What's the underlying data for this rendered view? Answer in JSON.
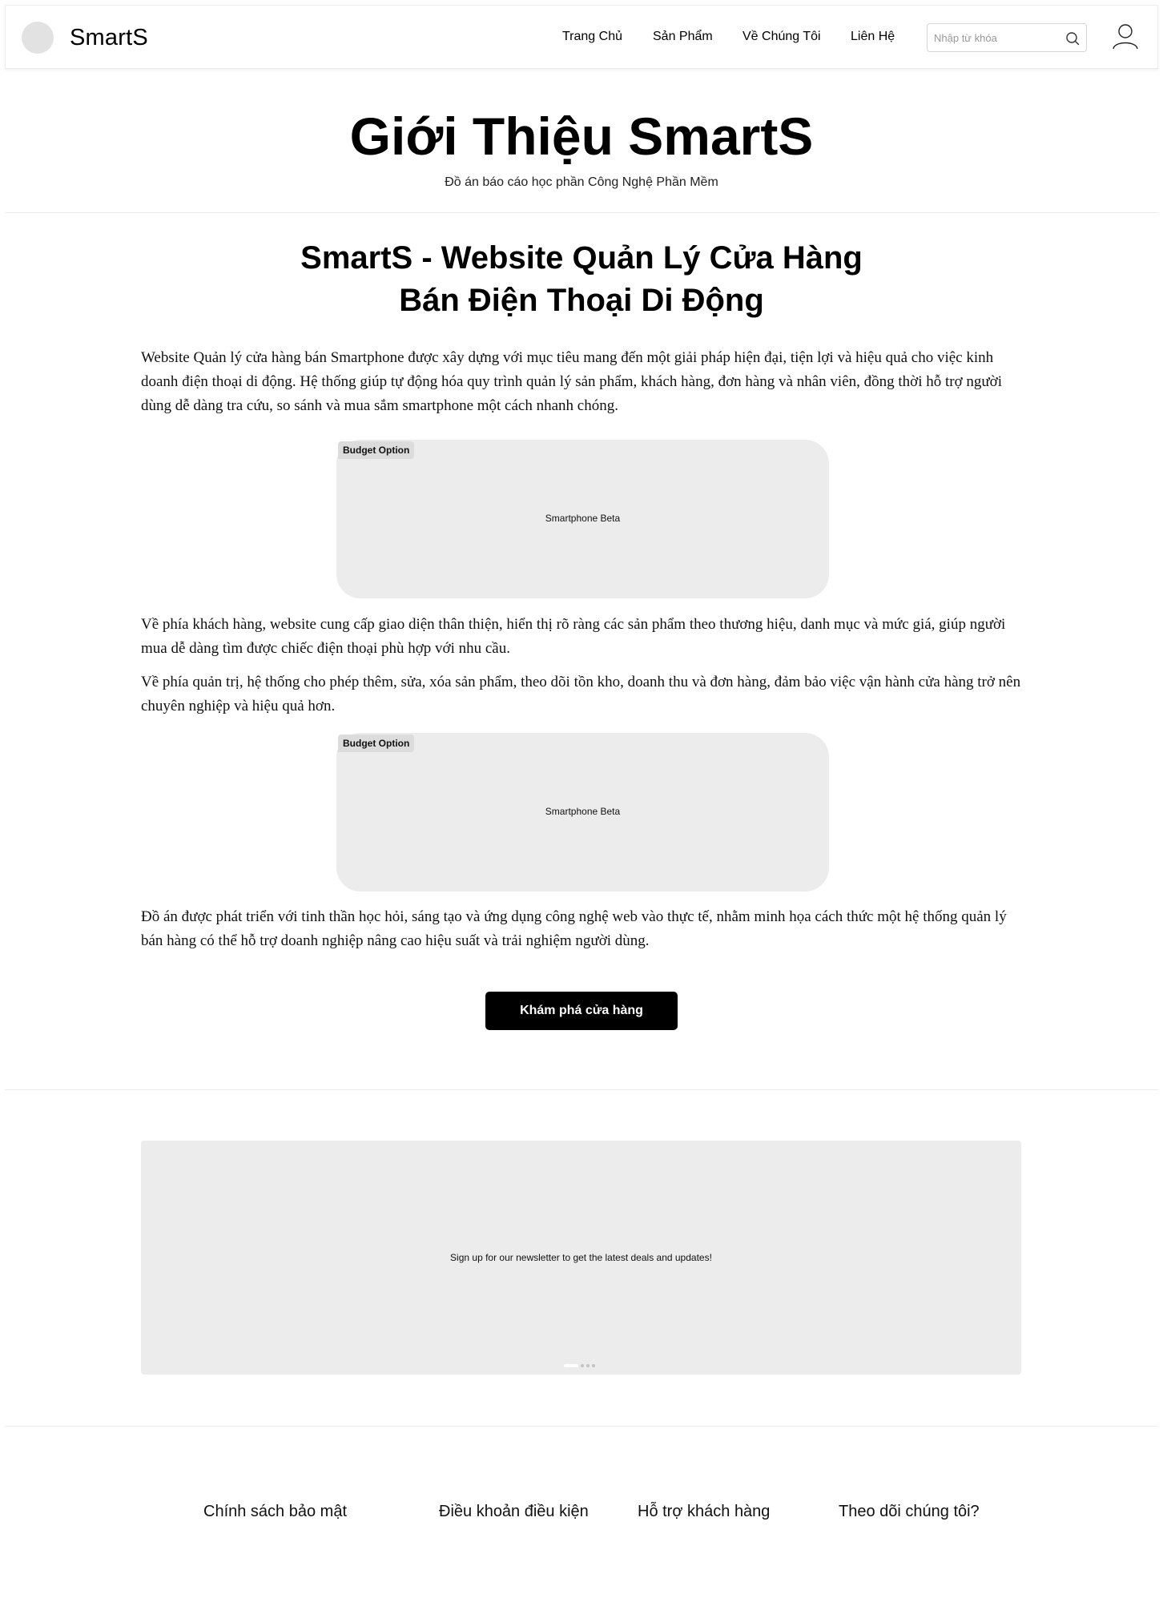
{
  "header": {
    "brand": "SmartS",
    "nav": [
      "Trang Chủ",
      "Sản Phẩm",
      "Về Chúng Tôi",
      "Liên Hệ"
    ],
    "search_placeholder": "Nhập từ khóa",
    "search_value": ""
  },
  "hero": {
    "title": "Giới Thiệu SmartS",
    "subtitle": "Đồ án báo cáo học phần Công Nghệ Phần Mềm"
  },
  "section": {
    "title_line1": "SmartS - Website Quản Lý Cửa Hàng",
    "title_line2": "Bán Điện Thoại Di Động",
    "p1": "Website Quản lý cửa hàng bán Smartphone được xây dựng với mục tiêu mang đến một giải pháp hiện đại, tiện lợi và hiệu quả cho việc kinh doanh điện thoại di động. Hệ thống giúp tự động hóa quy trình quản lý sản phẩm, khách hàng, đơn hàng và nhân viên, đồng thời hỗ trợ người dùng dễ dàng tra cứu, so sánh và mua sắm smartphone một cách nhanh chóng.",
    "card1": {
      "badge": "Budget Option",
      "label": "Smartphone Beta"
    },
    "p2": "Về phía khách hàng, website cung cấp giao diện thân thiện, hiển thị rõ ràng các sản phẩm theo thương hiệu, danh mục và mức giá, giúp người mua dễ dàng tìm được chiếc điện thoại phù hợp với nhu cầu.",
    "p3": "Về phía quản trị, hệ thống cho phép thêm, sửa, xóa sản phẩm, theo dõi tồn kho, doanh thu và đơn hàng, đảm bảo việc vận hành cửa hàng trở nên chuyên nghiệp và hiệu quả hơn.",
    "card2": {
      "badge": "Budget Option",
      "label": "Smartphone Beta"
    },
    "p4": "Đồ án được phát triển với tinh thần học hỏi, sáng tạo và ứng dụng công nghệ web vào thực tế, nhằm minh họa cách thức một hệ thống quản lý bán hàng có thể hỗ trợ doanh nghiệp nâng cao hiệu suất và trải nghiệm người dùng.",
    "cta": "Khám phá cửa hàng"
  },
  "newsletter": {
    "text": "Sign up for our newsletter to get the latest deals and updates!",
    "slides": 4,
    "active_slide": 1
  },
  "footer": {
    "links": [
      "Chính sách bảo mật",
      "Điều khoản điều kiện",
      "Hỗ trợ khách hàng",
      "Theo dõi chúng tôi?"
    ]
  },
  "colors": {
    "accent": "#000000",
    "placeholder_gray": "#ececec"
  }
}
